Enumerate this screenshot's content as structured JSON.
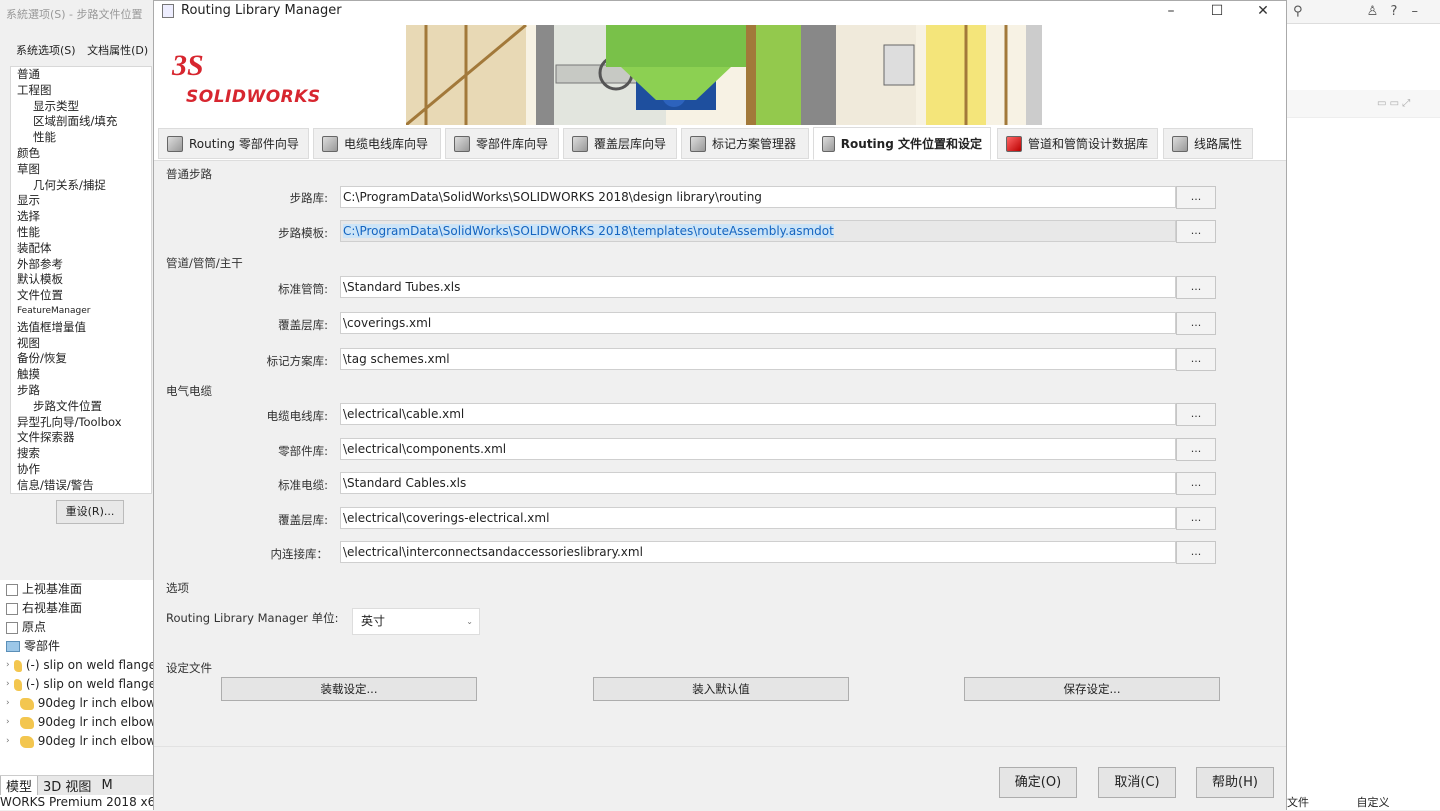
{
  "background_left": {
    "title": "系統選项(S) - 步路文件位置",
    "tabs": [
      "系统选项(S)",
      "文档属性(D)"
    ],
    "tree": [
      {
        "label": "普通",
        "level": 0
      },
      {
        "label": "工程图",
        "level": 0
      },
      {
        "label": "显示类型",
        "level": 1
      },
      {
        "label": "区域剖面线/填充",
        "level": 1
      },
      {
        "label": "性能",
        "level": 1
      },
      {
        "label": "颜色",
        "level": 0
      },
      {
        "label": "草图",
        "level": 0
      },
      {
        "label": "几何关系/捕捉",
        "level": 1
      },
      {
        "label": "显示",
        "level": 0
      },
      {
        "label": "选择",
        "level": 0
      },
      {
        "label": "性能",
        "level": 0
      },
      {
        "label": "装配体",
        "level": 0
      },
      {
        "label": "外部参考",
        "level": 0
      },
      {
        "label": "默认模板",
        "level": 0
      },
      {
        "label": "文件位置",
        "level": 0
      },
      {
        "label": "FeatureManager",
        "level": 0,
        "small": true
      },
      {
        "label": "选值框增量值",
        "level": 0
      },
      {
        "label": "视图",
        "level": 0
      },
      {
        "label": "备份/恢复",
        "level": 0
      },
      {
        "label": "触摸",
        "level": 0
      },
      {
        "label": "步路",
        "level": 0
      },
      {
        "label": "步路文件位置",
        "level": 1
      },
      {
        "label": "异型孔向导/Toolbox",
        "level": 0
      },
      {
        "label": "文件探索器",
        "level": 0
      },
      {
        "label": "搜索",
        "level": 0
      },
      {
        "label": "协作",
        "level": 0
      },
      {
        "label": "信息/错误/警告",
        "level": 0
      }
    ],
    "reset_label": "重设(R)..."
  },
  "feature_tree": [
    {
      "label": "上视基准面",
      "kind": "plane"
    },
    {
      "label": "右视基准面",
      "kind": "plane"
    },
    {
      "label": "原点",
      "kind": "origin"
    },
    {
      "label": "零部件",
      "kind": "folder"
    },
    {
      "label": "(-) slip on weld flange",
      "kind": "part"
    },
    {
      "label": "(-) slip on weld flange",
      "kind": "part"
    },
    {
      "label": "90deg lr inch elbow",
      "kind": "part"
    },
    {
      "label": "90deg lr inch elbow",
      "kind": "part"
    },
    {
      "label": "90deg lr inch elbow",
      "kind": "part"
    }
  ],
  "bottom_tabs": [
    "模型",
    "3D 视图",
    "M"
  ],
  "status_left": "WORKS Premium 2018 x64",
  "background_right": {
    "bottom_left": "文件",
    "bottom_mid": "自定义"
  },
  "dialog": {
    "title": "Routing Library Manager",
    "logo_mark": "3S",
    "logo_word": "SOLIDWORKS",
    "tabs": [
      {
        "label": "Routing 零部件向导",
        "active": false
      },
      {
        "label": "电缆电线库向导",
        "active": false
      },
      {
        "label": "零部件库向导",
        "active": false
      },
      {
        "label": "覆盖层库向导",
        "active": false
      },
      {
        "label": "标记方案管理器",
        "active": false
      },
      {
        "label": "Routing 文件位置和设定",
        "active": true
      },
      {
        "label": "管道和管筒设计数据库",
        "active": false
      },
      {
        "label": "线路属性",
        "active": false
      }
    ],
    "sections": {
      "general": "普通步路",
      "pipe": "管道/管筒/主干",
      "electrical": "电气电缆",
      "options": "选项",
      "settings_file": "设定文件"
    },
    "general_fields": [
      {
        "label": "步路库:",
        "value": "C:\\ProgramData\\SolidWorks\\SOLIDWORKS 2018\\design library\\routing",
        "selected": false
      },
      {
        "label": "步路模板:",
        "value": "C:\\ProgramData\\SolidWorks\\SOLIDWORKS 2018\\templates\\routeAssembly.asmdot",
        "selected": true
      }
    ],
    "pipe_fields": [
      {
        "label": "标准管筒:",
        "value": "\\Standard Tubes.xls"
      },
      {
        "label": "覆盖层库:",
        "value": "\\coverings.xml"
      },
      {
        "label": "标记方案库:",
        "value": "\\tag schemes.xml"
      }
    ],
    "electrical_fields": [
      {
        "label": "电缆电线库:",
        "value": "\\electrical\\cable.xml"
      },
      {
        "label": "零部件库:",
        "value": "\\electrical\\components.xml"
      },
      {
        "label": "标准电缆:",
        "value": "\\Standard Cables.xls"
      },
      {
        "label": "覆盖层库:",
        "value": "\\electrical\\coverings-electrical.xml"
      },
      {
        "label": "内连接库：",
        "value": "\\electrical\\interconnectsandaccessorieslibrary.xml"
      }
    ],
    "browse_label": "...",
    "units_label": "Routing Library Manager 单位:",
    "units_value": "英寸",
    "settings_buttons": [
      "装载设定...",
      "装入默认值",
      "保存设定..."
    ],
    "footer_buttons": [
      "确定(O)",
      "取消(C)",
      "帮助(H)"
    ],
    "colors": {
      "brand_red": "#d7262f",
      "selection": "#cce4f7"
    }
  }
}
